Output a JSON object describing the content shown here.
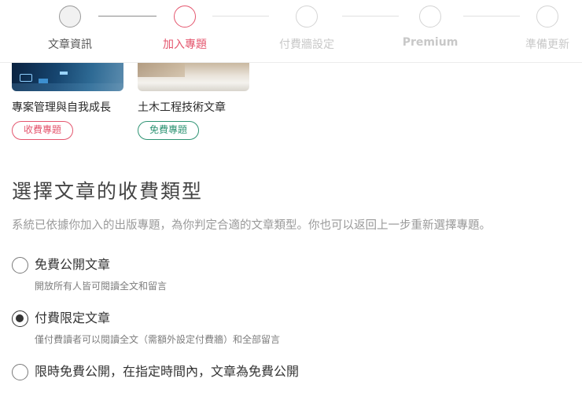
{
  "stepper": {
    "steps": [
      {
        "label": "文章資訊",
        "state": "done"
      },
      {
        "label": "加入專題",
        "state": "active"
      },
      {
        "label": "付費牆設定",
        "state": "upcoming"
      },
      {
        "label": "Premium",
        "state": "upcoming"
      },
      {
        "label": "準備更新",
        "state": "upcoming"
      }
    ]
  },
  "topics": [
    {
      "title": "專案管理與自我成長",
      "badge": "收費專題",
      "badge_type": "paid"
    },
    {
      "title": "土木工程技術文章",
      "badge": "免費專題",
      "badge_type": "free"
    }
  ],
  "section": {
    "title": "選擇文章的收費類型",
    "description": "系統已依據你加入的出版專題，為你判定合適的文章類型。你也可以返回上一步重新選擇專題。"
  },
  "options": [
    {
      "label": "免費公開文章",
      "sub": "開放所有人皆可閱讀全文和留言",
      "checked": false
    },
    {
      "label": "付費限定文章",
      "sub": "僅付費讀者可以閱讀全文（需額外設定付費牆）和全部留言",
      "checked": true
    },
    {
      "label": "限時免費公開，在指定時間內，文章為免費公開",
      "sub": "",
      "checked": false
    }
  ],
  "colors": {
    "accent": "#e4566e",
    "free": "#2f9474",
    "muted": "#c8c8c8"
  }
}
